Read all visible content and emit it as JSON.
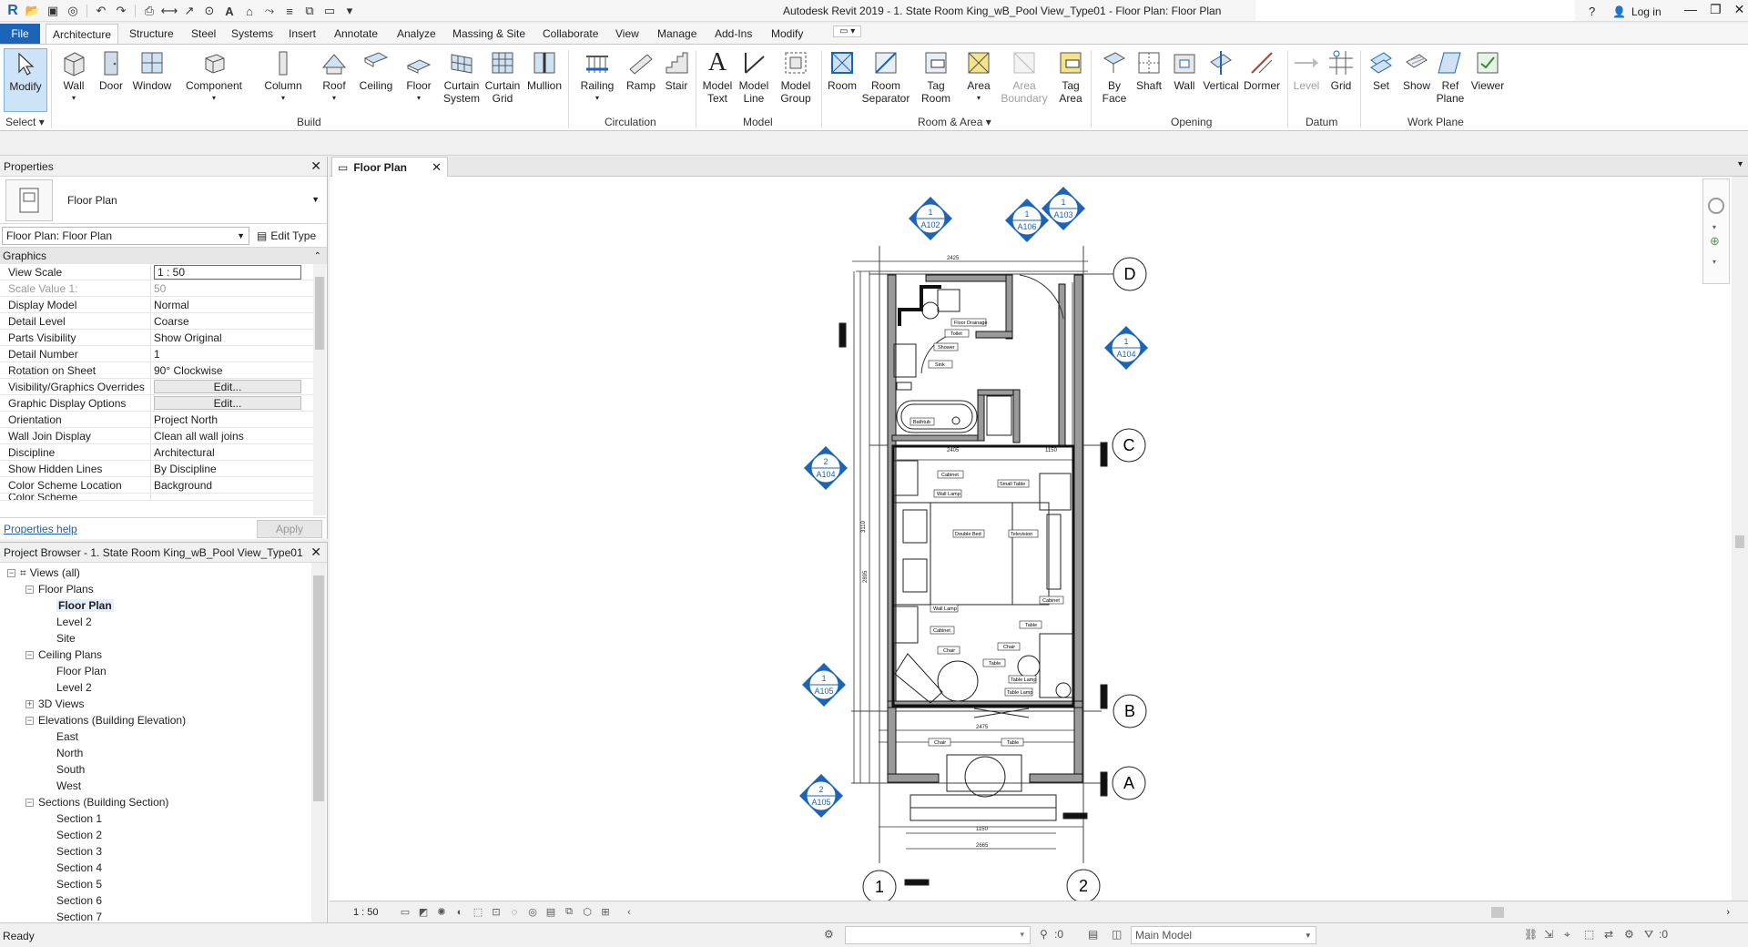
{
  "app": {
    "title": "Autodesk Revit 2019 - 1. State Room King_wB_Pool View_Type01 - Floor Plan: Floor Plan",
    "help": "?",
    "login": "Log in"
  },
  "tabs": {
    "file": "File",
    "architecture": "Architecture",
    "others": [
      "Structure",
      "Steel",
      "Systems",
      "Insert",
      "Annotate",
      "Analyze",
      "Massing & Site",
      "Collaborate",
      "View",
      "Manage",
      "Add-Ins",
      "Modify"
    ]
  },
  "ribbon": {
    "modify": "Modify",
    "select": "Select",
    "build": {
      "label": "Build",
      "items": [
        "Wall",
        "Door",
        "Window",
        "Component",
        "Column",
        "Roof",
        "Ceiling",
        "Floor",
        "Curtain\nSystem",
        "Curtain\nGrid",
        "Mullion"
      ]
    },
    "circulation": {
      "label": "Circulation",
      "items": [
        "Railing",
        "Ramp",
        "Stair"
      ]
    },
    "model": {
      "label": "Model",
      "items": [
        "Model\nText",
        "Model\nLine",
        "Model\nGroup"
      ]
    },
    "room_area": {
      "label": "Room & Area",
      "items": [
        "Room",
        "Room\nSeparator",
        "Tag\nRoom",
        "Area",
        "Area\nBoundary",
        "Tag\nArea"
      ]
    },
    "opening": {
      "label": "Opening",
      "items": [
        "By\nFace",
        "Shaft",
        "Wall",
        "Vertical",
        "Dormer"
      ]
    },
    "datum": {
      "label": "Datum",
      "items": [
        "Level",
        "Grid"
      ]
    },
    "work_plane": {
      "label": "Work Plane",
      "items": [
        "Set",
        "Show",
        "Ref\nPlane",
        "Viewer"
      ]
    }
  },
  "properties": {
    "title": "Properties",
    "type_name": "Floor Plan",
    "instance": "Floor Plan: Floor Plan",
    "edit_type": "Edit Type",
    "group": "Graphics",
    "rows": [
      {
        "name": "View Scale",
        "value": "1 : 50"
      },
      {
        "name": "Scale Value    1:",
        "value": "50"
      },
      {
        "name": "Display Model",
        "value": "Normal"
      },
      {
        "name": "Detail Level",
        "value": "Coarse"
      },
      {
        "name": "Parts Visibility",
        "value": "Show Original"
      },
      {
        "name": "Detail Number",
        "value": "1"
      },
      {
        "name": "Rotation on Sheet",
        "value": "90° Clockwise"
      },
      {
        "name": "Visibility/Graphics Overrides",
        "value": "Edit..."
      },
      {
        "name": "Graphic Display Options",
        "value": "Edit..."
      },
      {
        "name": "Orientation",
        "value": "Project North"
      },
      {
        "name": "Wall Join Display",
        "value": "Clean all wall joins"
      },
      {
        "name": "Discipline",
        "value": "Architectural"
      },
      {
        "name": "Show Hidden Lines",
        "value": "By Discipline"
      },
      {
        "name": "Color Scheme Location",
        "value": "Background"
      },
      {
        "name": "Color Scheme",
        "value": ""
      }
    ],
    "help": "Properties help",
    "apply": "Apply"
  },
  "browser": {
    "title": "Project Browser - 1. State Room King_wB_Pool View_Type01",
    "nodes": [
      {
        "label": "Views (all)",
        "level": 0,
        "toggle": "−"
      },
      {
        "label": "Floor Plans",
        "level": 1,
        "toggle": "−"
      },
      {
        "label": "Floor Plan",
        "level": 2,
        "toggle": ""
      },
      {
        "label": "Level 2",
        "level": 2,
        "toggle": ""
      },
      {
        "label": "Site",
        "level": 2,
        "toggle": ""
      },
      {
        "label": "Ceiling Plans",
        "level": 1,
        "toggle": "−"
      },
      {
        "label": "Floor Plan",
        "level": 2,
        "toggle": ""
      },
      {
        "label": "Level 2",
        "level": 2,
        "toggle": ""
      },
      {
        "label": "3D Views",
        "level": 1,
        "toggle": "+"
      },
      {
        "label": "Elevations (Building Elevation)",
        "level": 1,
        "toggle": "−"
      },
      {
        "label": "East",
        "level": 2,
        "toggle": ""
      },
      {
        "label": "North",
        "level": 2,
        "toggle": ""
      },
      {
        "label": "South",
        "level": 2,
        "toggle": ""
      },
      {
        "label": "West",
        "level": 2,
        "toggle": ""
      },
      {
        "label": "Sections (Building Section)",
        "level": 1,
        "toggle": "−"
      },
      {
        "label": "Section 1",
        "level": 2,
        "toggle": ""
      },
      {
        "label": "Section 2",
        "level": 2,
        "toggle": ""
      },
      {
        "label": "Section 3",
        "level": 2,
        "toggle": ""
      },
      {
        "label": "Section 4",
        "level": 2,
        "toggle": ""
      },
      {
        "label": "Section 5",
        "level": 2,
        "toggle": ""
      },
      {
        "label": "Section 6",
        "level": 2,
        "toggle": ""
      },
      {
        "label": "Section 7",
        "level": 2,
        "toggle": ""
      }
    ]
  },
  "view": {
    "tab": "Floor Plan",
    "scale": "1 : 50",
    "grids": {
      "d": "D",
      "c": "C",
      "b": "B",
      "a": "A",
      "g1": "1",
      "g2": "2"
    },
    "elev_marks": [
      {
        "num": "1",
        "sheet": "A102"
      },
      {
        "num": "1",
        "sheet": "A106"
      },
      {
        "num": "1",
        "sheet": "A103"
      },
      {
        "num": "1",
        "sheet": "A104"
      },
      {
        "num": "2",
        "sheet": "A104"
      },
      {
        "num": "1",
        "sheet": "A105"
      },
      {
        "num": "2",
        "sheet": "A105"
      }
    ],
    "tags": {
      "floor_drainage": "Floor Drainage",
      "toilet": "Toilet",
      "shower": "Shower",
      "sink": "Sink",
      "bathtub": "Bathtub",
      "cabinet1": "Cabinet",
      "small_table": "Small Table",
      "wall_lamp1": "Wall Lamp",
      "double_bed": "Double Bed",
      "television": "Television",
      "cabinet2": "Cabinet",
      "wall_lamp2": "Wall Lamp",
      "cabinet3": "Cabinet",
      "table1": "Table",
      "chair1": "Chair",
      "chair2": "Chair",
      "table2": "Table",
      "table_lamp1": "Table Lamp",
      "table_lamp2": "Table Lamp",
      "chair3": "Chair",
      "table3": "Table"
    },
    "dims": {
      "top_total": "2425",
      "mid": "2405",
      "side": "3110",
      "right": "2895",
      "bottom_a": "1150",
      "bottom_b": "2665",
      "w1": "1150",
      "w2": "2475"
    }
  },
  "status": {
    "text": "Ready",
    "model": "Main Model",
    "zero1": ":0",
    "zero2": ":0"
  }
}
